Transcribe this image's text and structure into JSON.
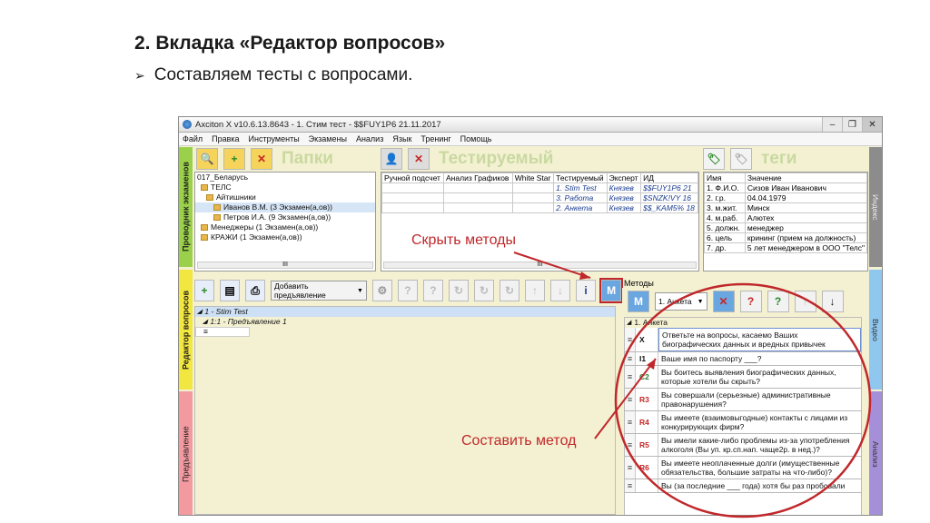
{
  "slide": {
    "title": "2. Вкладка «Редактор вопросов»",
    "bullet": "Составляем тесты с вопросами."
  },
  "window": {
    "title": "Axciton X v10.6.13.8643 - 1. Стим тест - $$FUY1P6 21.11.2017",
    "controls": [
      "‒",
      "❐",
      "✕"
    ]
  },
  "menu": [
    "Файл",
    "Правка",
    "Инструменты",
    "Экзамены",
    "Анализ",
    "Язык",
    "Тренинг",
    "Помощь"
  ],
  "side_tabs": {
    "exam_guide": "Проводник экзаменов",
    "question_editor": "Редактор вопросов",
    "presentation": "Предъявление"
  },
  "right_tabs": {
    "index": "Индекс",
    "video": "Видео",
    "analysis": "Анализ"
  },
  "folders": {
    "label": "Папки",
    "tree": [
      "017_Беларусь",
      "ТЕЛС",
      "Айтишники",
      "Иванов В.М. (3 Экзамен(а,ов))",
      "Петров И.А. (9 Экзамен(а,ов))",
      "Менеджеры (1 Экзамен(а,ов))",
      "КРАЖИ (1 Экзамен(а,ов))"
    ],
    "scroll_mark": "III"
  },
  "tested": {
    "label": "Тестируемый",
    "columns": [
      "Ручной подсчет",
      "Анализ Графиков",
      "White Star",
      "Тестируемый",
      "Эксперт",
      "ИД"
    ],
    "rows": [
      {
        "test": "1. Stim Test",
        "expert": "Князев",
        "id": "$$FUY1P6",
        "extra": "21"
      },
      {
        "test": "3. Работа",
        "expert": "Князев",
        "id": "$SNZK!VY",
        "extra": "16"
      },
      {
        "test": "2. Анкета",
        "expert": "Князев",
        "id": "$$_KAM5%",
        "extra": "18"
      }
    ],
    "scroll_mark": "III"
  },
  "tags": {
    "label": "теги",
    "columns": [
      "Имя",
      "Значение"
    ],
    "rows": [
      [
        "1. Ф.И.О.",
        "Сизов Иван Иванович"
      ],
      [
        "2. г.р.",
        "04.04.1979"
      ],
      [
        "3. м.жит.",
        "Минск"
      ],
      [
        "4. м.раб.",
        "Алютех"
      ],
      [
        "5. должн.",
        "менеджер"
      ],
      [
        "6. цель",
        "кpининг (прием на должность)"
      ],
      [
        "7. др.",
        "5 лет менеджером в ООО \"Телс\""
      ]
    ]
  },
  "editor": {
    "add_presentation": "Добавить предъявление",
    "methods_label": "Методы",
    "stim_item": "1 - Stim Test",
    "presentation_item": "1:1 - Предъявление 1",
    "method_select": "1. Анкета",
    "group_label": "1. Анкета",
    "questions": [
      {
        "code": "X",
        "text": "Ответьте на вопросы, касаемо Ваших биографических данных и вредных привычек",
        "color": "#111111"
      },
      {
        "code": "I1",
        "text": "Ваше имя по паспорту ___?",
        "color": "#111111"
      },
      {
        "code": "C2",
        "text": "Вы боитесь выявления биографических данных, которые хотели бы скрыть?",
        "color": "#2e7d32"
      },
      {
        "code": "R3",
        "text": "Вы совершали (серьезные) административные правонарушения?",
        "color": "#c62828"
      },
      {
        "code": "R4",
        "text": "Вы имеете (взаимовыгодные) контакты с лицами из конкурирующих фирм?",
        "color": "#c62828"
      },
      {
        "code": "R5",
        "text": "Вы имели какие-либо проблемы из-за употребления алкоголя (Вы уп. кр.сп.нап. чаще2р. в нед.)?",
        "color": "#c62828"
      },
      {
        "code": "R6",
        "text": "Вы имеете неоплаченные долги (имущественные обязательства, большие затраты на что-либо)?",
        "color": "#c62828"
      },
      {
        "code": "",
        "text": "Вы (за последние ___ года) хотя бы раз пробовали",
        "color": "#111111"
      }
    ]
  },
  "annotations": {
    "hide_methods": "Скрыть методы",
    "compose_method": "Составить метод"
  },
  "colors": {
    "annotation": "#c0282b",
    "panel_bg": "#f4f1d2",
    "tab_green": "#9bd14a",
    "tab_yellow": "#f2e640",
    "tab_pink": "#f29aa0"
  }
}
